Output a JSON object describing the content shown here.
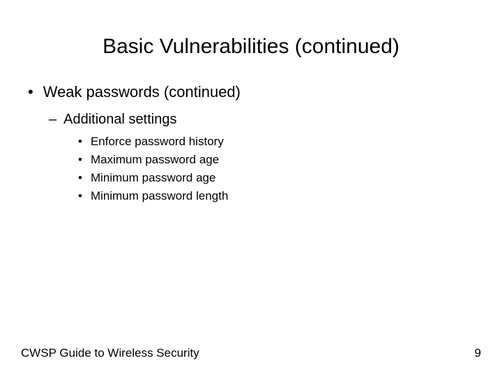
{
  "slide": {
    "title": "Basic Vulnerabilities (continued)",
    "level1": {
      "bullet": "•",
      "text": "Weak passwords (continued)"
    },
    "level2": {
      "bullet": "–",
      "text": "Additional settings"
    },
    "level3": [
      {
        "bullet": "•",
        "text": "Enforce password history"
      },
      {
        "bullet": "•",
        "text": "Maximum password age"
      },
      {
        "bullet": "•",
        "text": "Minimum password age"
      },
      {
        "bullet": "•",
        "text": "Minimum password length"
      }
    ],
    "footer": {
      "left": "CWSP Guide to Wireless Security",
      "right": "9"
    }
  }
}
